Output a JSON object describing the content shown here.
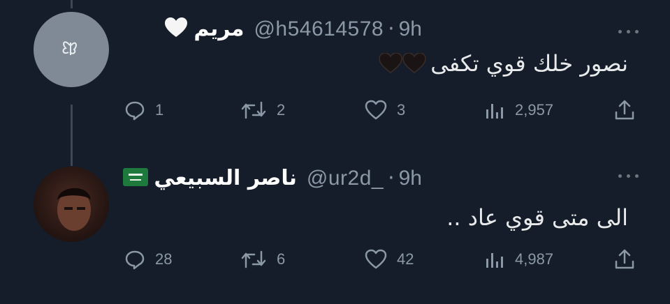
{
  "tweets": [
    {
      "name": "مريم",
      "handle": "@h54614578",
      "time": "9h",
      "text": "نصور خلك قوي تكفى",
      "replies": "1",
      "retweets": "2",
      "likes": "3",
      "views": "2,957"
    },
    {
      "name": "ناصر السبيعي",
      "handle": "@ur2d_",
      "time": "9h",
      "text": "الى متى قوي عاد ..",
      "replies": "28",
      "retweets": "6",
      "likes": "42",
      "views": "4,987"
    }
  ],
  "separator_dot": "·",
  "colors": {
    "background": "#141d29",
    "text": "#e7e9ea",
    "muted": "#8b98a5",
    "thread_line": "#3d4852"
  },
  "icons": {
    "white_heart": "white-heart-emoji",
    "black_heart": "black-heart-emoji",
    "flag": "saudi-flag-emoji",
    "reply": "reply-icon",
    "retweet": "retweet-icon",
    "like": "like-icon",
    "views": "views-icon",
    "share": "share-icon"
  }
}
